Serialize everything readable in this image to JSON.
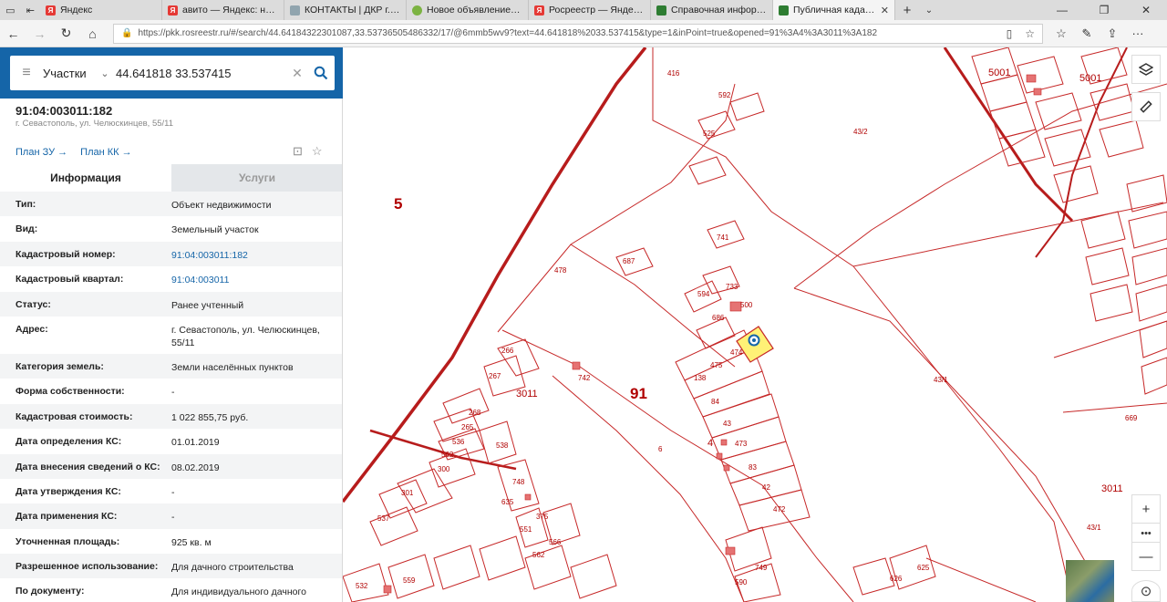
{
  "browser": {
    "tabs": [
      {
        "label": "Яндекс",
        "favicon": "yandex-icon",
        "color": "#e53935",
        "glyph": "Я"
      },
      {
        "label": "авито — Яндекс: нашлось",
        "favicon": "yandex-icon",
        "color": "#e53935",
        "glyph": "Я"
      },
      {
        "label": "КОНТАКТЫ | ДКР г.Севасто",
        "favicon": "page-icon",
        "color": "#90a4ae",
        "glyph": "▬"
      },
      {
        "label": "Новое объявление — Объ",
        "favicon": "avito-icon",
        "color": "#7cb342",
        "glyph": "●"
      },
      {
        "label": "Росреестр — Яндекс: нашл",
        "favicon": "yandex-icon",
        "color": "#e53935",
        "glyph": "Я"
      },
      {
        "label": "Справочная информация",
        "favicon": "rosreestr-icon",
        "color": "#2e7d32",
        "glyph": "✎"
      },
      {
        "label": "Публичная кадастрова",
        "favicon": "rosreestr-icon",
        "color": "#2e7d32",
        "glyph": "✎",
        "active": true
      }
    ],
    "url": "https://pkk.rosreestr.ru/#/search/44.64184322301087,33.53736505486332/17/@6mmb5wv9?text=44.641818%2033.537415&type=1&inPoint=true&opened=91%3A4%3A3011%3A182"
  },
  "search": {
    "type_label": "Участки",
    "query": "44.641818 33.537415"
  },
  "object": {
    "cad_number": "91:04:003011:182",
    "address_short": "г. Севастополь, ул. Челюскинцев, 55/11",
    "plan_zu": "План ЗУ",
    "plan_kk": "План КК"
  },
  "tabs": {
    "info": "Информация",
    "services": "Услуги"
  },
  "info_rows": [
    {
      "key": "Тип:",
      "value": "Объект недвижимости"
    },
    {
      "key": "Вид:",
      "value": "Земельный участок"
    },
    {
      "key": "Кадастровый номер:",
      "value": "91:04:003011:182",
      "link": true
    },
    {
      "key": "Кадастровый квартал:",
      "value": "91:04:003011",
      "link": true
    },
    {
      "key": "Статус:",
      "value": "Ранее учтенный"
    },
    {
      "key": "Адрес:",
      "value": "г. Севастополь, ул. Челюскинцев, 55/11",
      "tall": true
    },
    {
      "key": "Категория земель:",
      "value": "Земли населённых пунктов"
    },
    {
      "key": "Форма собственности:",
      "value": "-"
    },
    {
      "key": "Кадастровая стоимость:",
      "value": "1 022 855,75 руб."
    },
    {
      "key": "Дата определения КС:",
      "value": "01.01.2019"
    },
    {
      "key": "Дата внесения сведений о КС:",
      "value": "08.02.2019"
    },
    {
      "key": "Дата утверждения КС:",
      "value": "-"
    },
    {
      "key": "Дата применения КС:",
      "value": "-"
    },
    {
      "key": "Уточненная площадь:",
      "value": "925 кв. м"
    },
    {
      "key": "Разрешенное использование:",
      "value": "Для дачного строительства"
    },
    {
      "key": "По документу:",
      "value": "Для индивидуального дачного"
    }
  ],
  "map_labels": {
    "l416": "416",
    "l592": "592",
    "l525": "525",
    "l43_2": "43/2",
    "l5": "5",
    "l741": "741",
    "l478": "478",
    "l687": "687",
    "l733": "733",
    "l594": "594",
    "l500": "500",
    "l686": "686",
    "l475": "475",
    "l474": "474",
    "l266": "266",
    "l267": "267",
    "l3011a": "3011",
    "l742": "742",
    "l91": "91",
    "l138": "138",
    "l84": "84",
    "l43": "43",
    "l473": "473",
    "l6": "6",
    "l4": "4",
    "l83": "83",
    "l42": "42",
    "l472": "472",
    "l268": "268",
    "l265": "265",
    "l536": "536",
    "l538": "538",
    "l562": "562",
    "l300": "300",
    "l748": "748",
    "l301": "301",
    "l537": "537",
    "l635": "635",
    "l375": "375",
    "l551": "551",
    "l566": "566",
    "l43_1a": "43/1",
    "l669": "669",
    "l3011b": "3011",
    "l43_1b": "43/1",
    "l5001a": "5001",
    "l5001b": "5001",
    "l749": "749",
    "l590": "590",
    "l626": "626",
    "l625": "625",
    "l532": "532",
    "l559": "559",
    "l562b": "562"
  },
  "colors": {
    "brand": "#1565a8",
    "parcel_line": "#c62828",
    "selected_fill": "#fff176",
    "major_line": "#b71c1c"
  }
}
